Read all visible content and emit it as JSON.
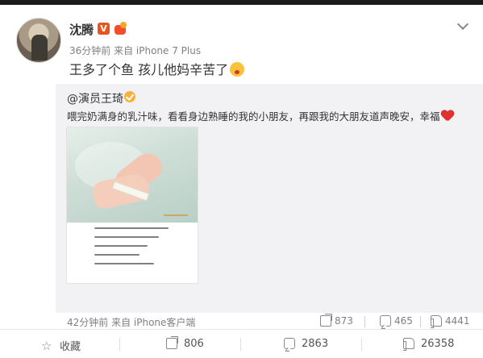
{
  "post": {
    "username": "沈腾",
    "vip_badge": "V",
    "meta": "36分钟前 来自 iPhone 7 Plus",
    "text": "王多了个鱼 孩儿他妈辛苦了"
  },
  "repost": {
    "author": "@演员王琦",
    "text": "喂完奶满身的乳汁味，看看身边熟睡的我的小朋友，再跟我的大朋友道声晚安，幸福",
    "meta": "42分钟前 来自 iPhone客户端",
    "share_count": "873",
    "comment_count": "465",
    "like_count": "4441"
  },
  "actions": {
    "favorite_label": "收藏",
    "share_count": "806",
    "comment_count": "2863",
    "like_count": "26358"
  },
  "colors": {
    "accent_heart": "#e0312f",
    "vip_badge": "#e8541e",
    "repost_bg": "#f2f2f5"
  },
  "icons": [
    "more-chevron-icon",
    "share-icon",
    "comment-icon",
    "like-icon",
    "favorite-icon"
  ]
}
